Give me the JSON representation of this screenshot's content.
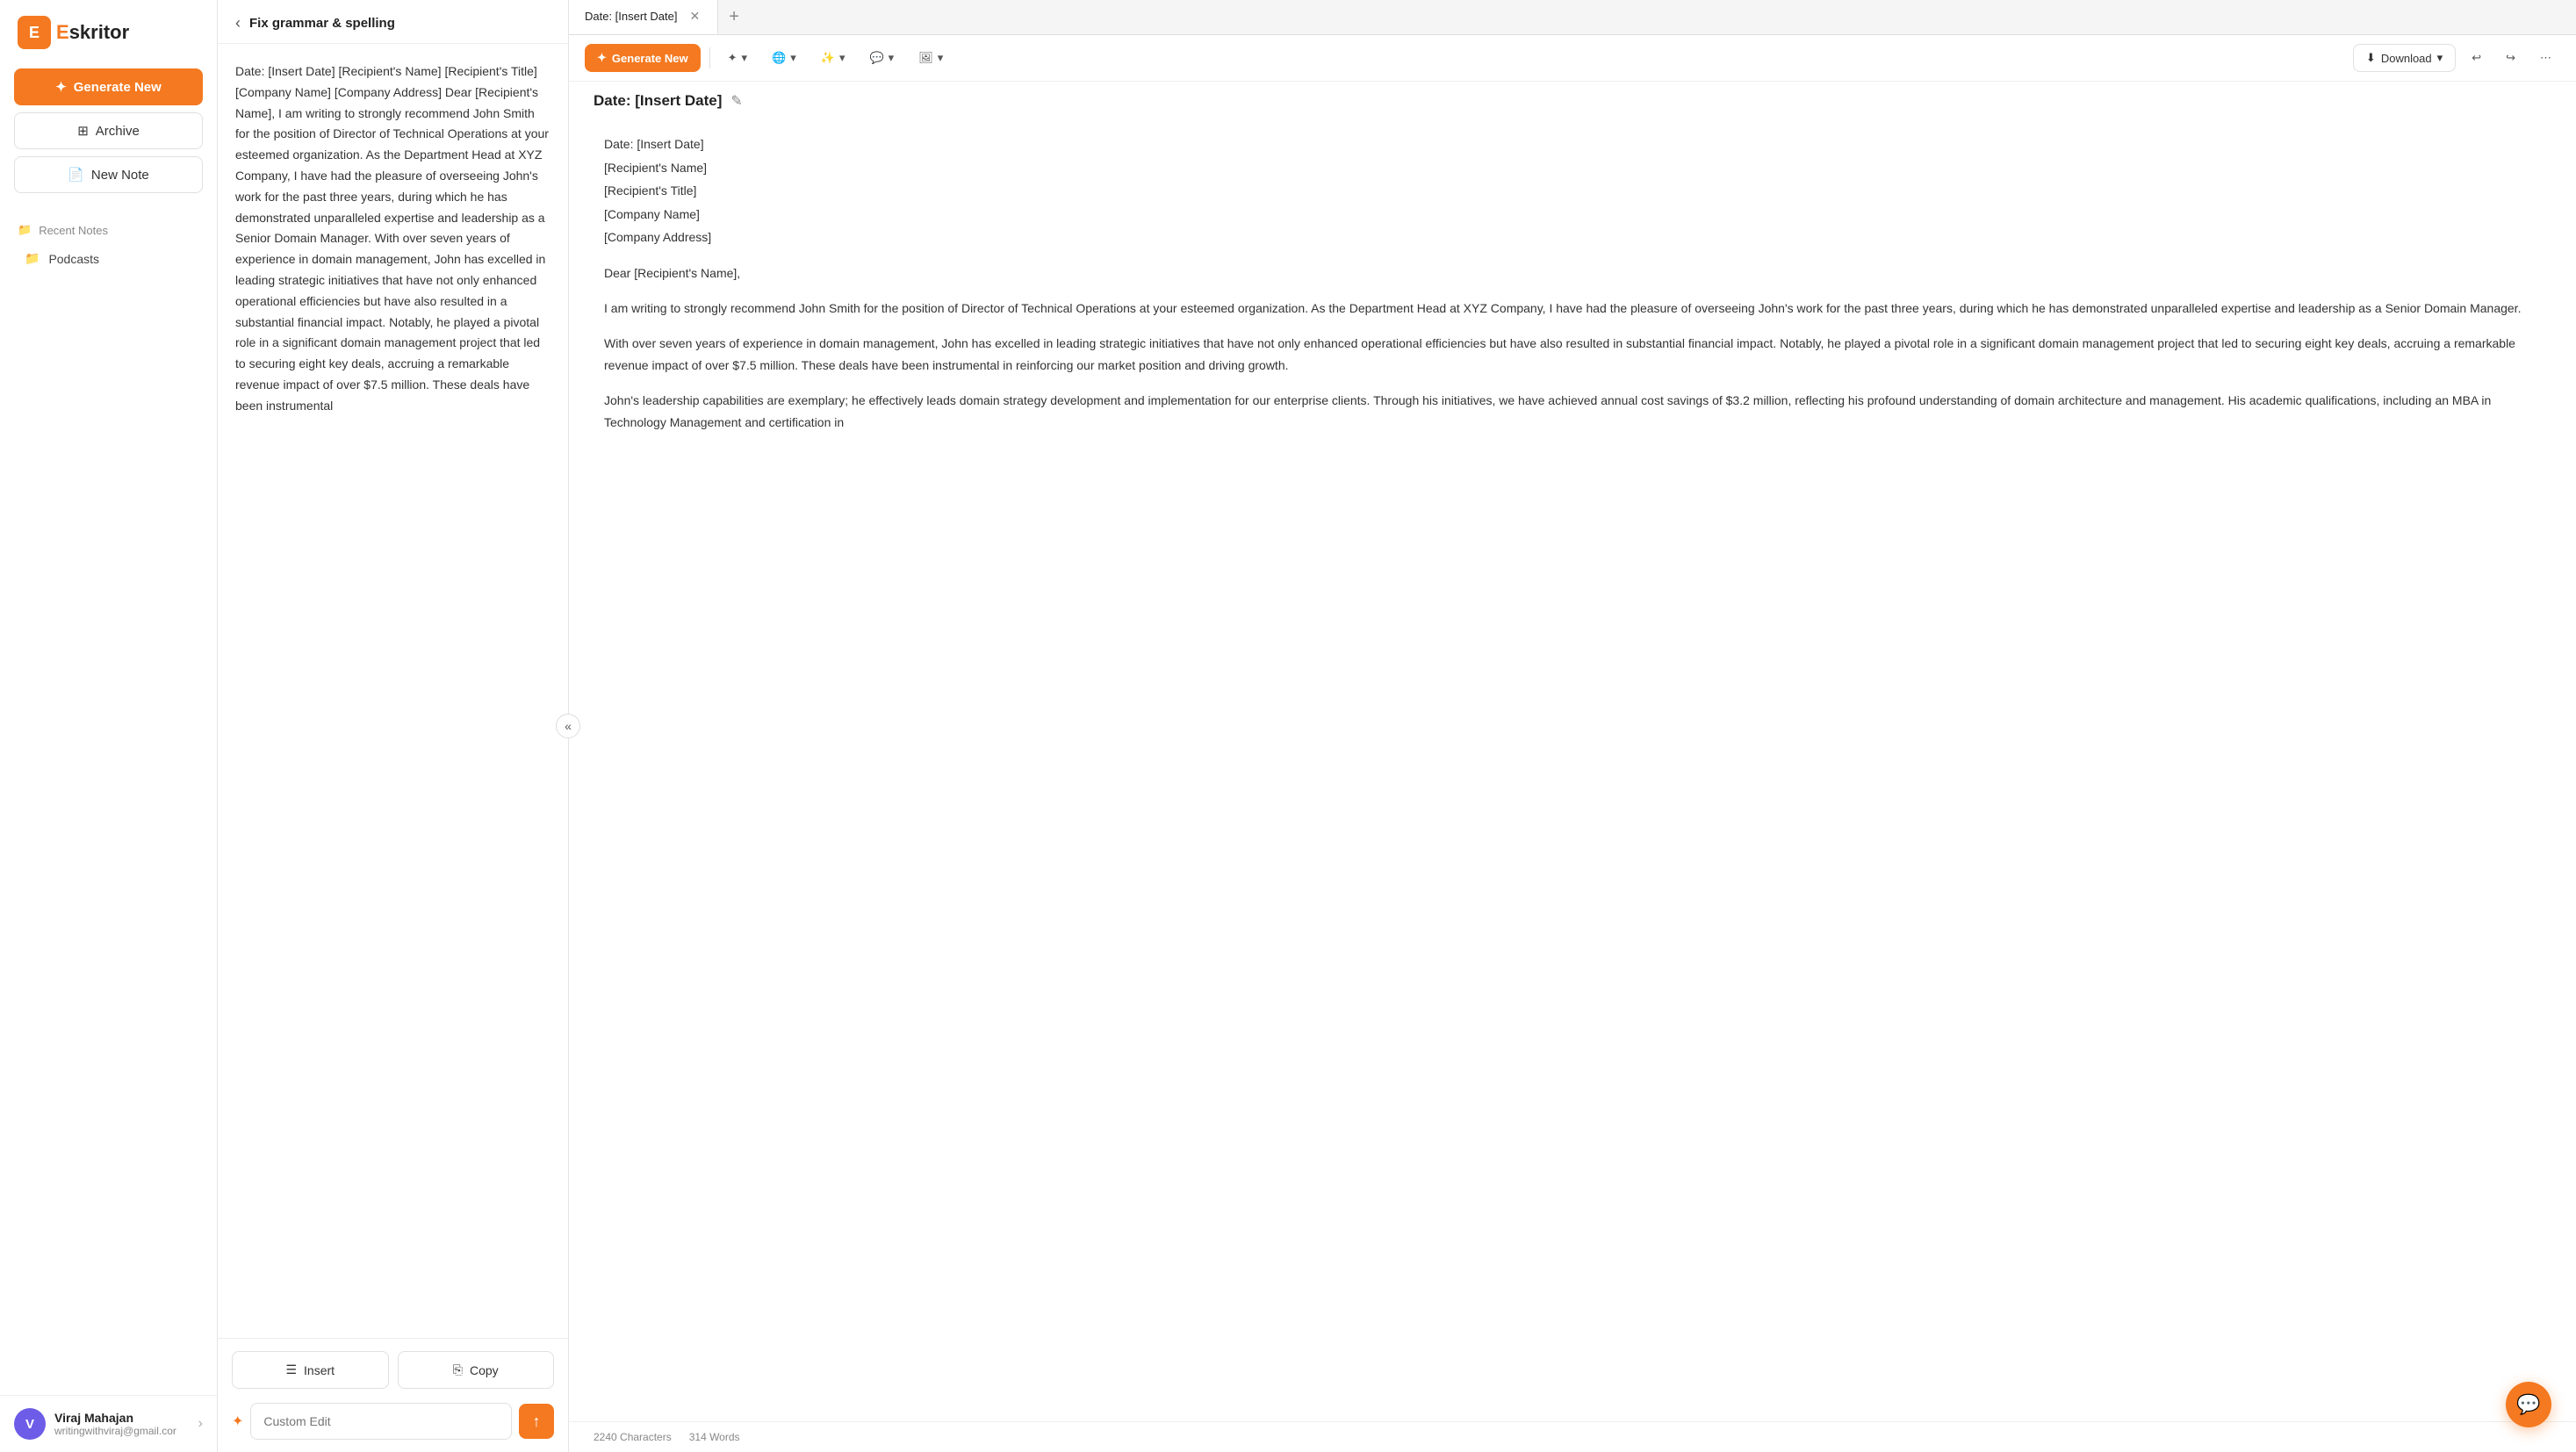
{
  "app": {
    "logo_letter": "E",
    "logo_name_prefix": "E",
    "logo_name_suffix": "skritor"
  },
  "sidebar": {
    "generate_btn": "Generate New",
    "archive_btn": "Archive",
    "new_note_btn": "New Note",
    "recent_notes_label": "Recent Notes",
    "podcasts_label": "Podcasts",
    "user": {
      "initials": "V",
      "name": "Viraj Mahajan",
      "email": "writingwithviraj@gmail.cor"
    }
  },
  "middle_panel": {
    "header_back": "←",
    "header_title": "Fix grammar & spelling",
    "content_text": "Date: [Insert Date] [Recipient's Name] [Recipient's Title] [Company Name] [Company Address] Dear [Recipient's Name], I am writing to strongly recommend John Smith for the position of Director of Technical Operations at your esteemed organization. As the Department Head at XYZ Company, I have had the pleasure of overseeing John's work for the past three years, during which he has demonstrated unparalleled expertise and leadership as a Senior Domain Manager. With over seven years of experience in domain management, John has excelled in leading strategic initiatives that have not only enhanced operational efficiencies but have also resulted in a substantial financial impact. Notably, he played a pivotal role in a significant domain management project that led to securing eight key deals, accruing a remarkable revenue impact of over $7.5 million. These deals have been instrumental",
    "insert_btn": "Insert",
    "copy_btn": "Copy",
    "custom_edit_placeholder": "Custom Edit"
  },
  "right_panel": {
    "tab_title": "Date: [Insert Date]",
    "doc_title": "Date: [Insert Date]",
    "generate_btn": "Generate New",
    "download_btn": "Download",
    "doc_lines": [
      "Date: [Insert Date]",
      "[Recipient's Name]",
      "[Recipient's Title]",
      "[Company Name]",
      "[Company Address]",
      "Dear [Recipient's Name],",
      "I am writing to strongly recommend John Smith for the position of Director of Technical Operations at your esteemed organization. As the Department Head at XYZ Company, I have had the pleasure of overseeing John's work for the past three years, during which he has demonstrated unparalleled expertise and leadership as a Senior Domain Manager.",
      "With over seven years of experience in domain management, John has excelled in leading strategic initiatives that have not only enhanced operational efficiencies but have also resulted in substantial financial impact. Notably, he played a pivotal role in a significant domain management project that led to securing eight key deals, accruing a remarkable revenue impact of over $7.5 million. These deals have been instrumental in reinforcing our market position and driving growth.",
      "John's leadership capabilities are exemplary; he effectively leads domain strategy development and implementation for our enterprise clients. Through his initiatives, we have achieved annual cost savings of $3.2 million, reflecting his profound understanding of domain architecture and management. His academic qualifications, including an MBA in Technology Management and certification in"
    ],
    "characters": "2240 Characters",
    "words": "314 Words"
  },
  "icons": {
    "generate": "✦",
    "archive": "⊞",
    "new_note": "📄",
    "recent_notes": "📁",
    "podcasts": "📁",
    "back": "‹",
    "insert": "☰",
    "copy": "⎘",
    "wand": "✦",
    "send": "↑",
    "edit": "✎",
    "undo": "↩",
    "redo": "↪",
    "download": "⬇",
    "chat": "💬",
    "image": "🖼",
    "brush": "🖌",
    "magic": "✨",
    "chevron_down": "▾"
  }
}
